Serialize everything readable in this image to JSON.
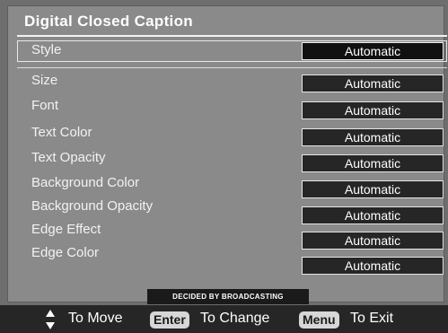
{
  "menu": {
    "title": "Digital Closed Caption",
    "style": {
      "label": "Style",
      "value": "Automatic"
    },
    "items": [
      {
        "label": "Size",
        "value": "Automatic"
      },
      {
        "label": "Font",
        "value": "Automatic"
      },
      {
        "label": "Text Color",
        "value": "Automatic"
      },
      {
        "label": "Text Opacity",
        "value": "Automatic"
      },
      {
        "label": "Background Color",
        "value": "Automatic"
      },
      {
        "label": "Background Opacity",
        "value": "Automatic"
      },
      {
        "label": "Edge Effect",
        "value": "Automatic"
      },
      {
        "label": "Edge Color",
        "value": "Automatic"
      }
    ],
    "note": "DECIDED BY BROADCASTING"
  },
  "hints": {
    "move_icon": "up-down-arrow-icon",
    "move_text": "To Move",
    "enter_key": "Enter",
    "change_text": "To Change",
    "menu_key": "Menu",
    "exit_text": "To Exit"
  },
  "colors": {
    "panel": "#8a8a8a",
    "value_box": "#262626",
    "hint_bar": "#262626"
  }
}
